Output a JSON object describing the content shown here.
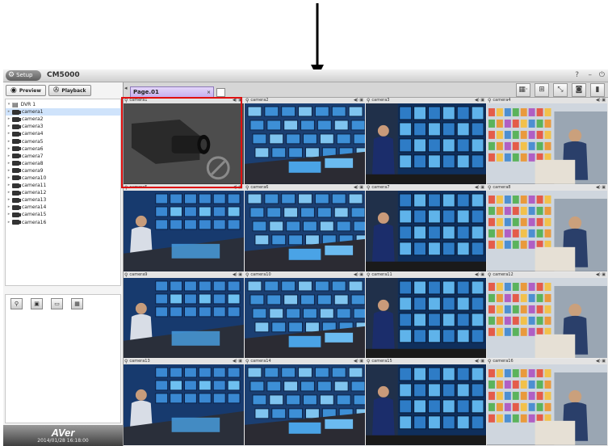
{
  "app": {
    "setup_label": "Setup",
    "title": "CM5000",
    "help_glyph": "?",
    "min_glyph": "–",
    "power_glyph": "⏻"
  },
  "left": {
    "tabs": [
      {
        "label": "Preview",
        "icon": "eye-icon"
      },
      {
        "label": "Playback",
        "icon": "film-reel-icon"
      }
    ],
    "dvr_label": "DVR 1",
    "cameras": [
      "camera1",
      "camera2",
      "camera3",
      "camera4",
      "camera5",
      "camera6",
      "camera7",
      "camera8",
      "camera9",
      "camera10",
      "camera11",
      "camera12",
      "camera13",
      "camera14",
      "camera15",
      "camera16"
    ],
    "selected_camera": "camera1",
    "tools": [
      {
        "icon": "person-icon",
        "glyph": "⚲"
      },
      {
        "icon": "image-icon",
        "glyph": "▣"
      },
      {
        "icon": "monitor-icon",
        "glyph": "▭"
      },
      {
        "icon": "monitor-group-icon",
        "glyph": "▦"
      }
    ],
    "brand": "AVer",
    "datetime": "2014/01/28 16:18:00"
  },
  "main": {
    "page_tab": "Page.01",
    "page_tab_close": "×",
    "layout_tools": [
      "▦·",
      "⊞",
      "⤡",
      "◙",
      "▮"
    ],
    "tiles": [
      {
        "name": "camera1",
        "scene": "camera"
      },
      {
        "name": "camera2",
        "scene": "monitors"
      },
      {
        "name": "camera3",
        "scene": "guard"
      },
      {
        "name": "camera4",
        "scene": "store"
      },
      {
        "name": "camera5",
        "scene": "control"
      },
      {
        "name": "camera6",
        "scene": "monitors"
      },
      {
        "name": "camera7",
        "scene": "guard"
      },
      {
        "name": "camera8",
        "scene": "store"
      },
      {
        "name": "camera9",
        "scene": "control"
      },
      {
        "name": "camera10",
        "scene": "monitors"
      },
      {
        "name": "camera11",
        "scene": "guard"
      },
      {
        "name": "camera12",
        "scene": "store"
      },
      {
        "name": "camera13",
        "scene": "control"
      },
      {
        "name": "camera14",
        "scene": "monitors"
      },
      {
        "name": "camera15",
        "scene": "guard"
      },
      {
        "name": "camera16",
        "scene": "store"
      }
    ]
  },
  "colors": {
    "highlight": "#e01010",
    "page_tab": "#c6b0ee",
    "selection": "#cfe3fb"
  }
}
